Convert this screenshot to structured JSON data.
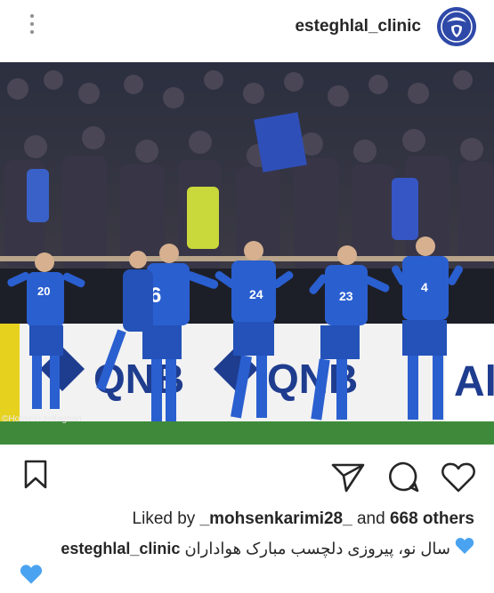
{
  "header": {
    "username": "esteghlal_clinic",
    "more_icon": "more-vertical-icon",
    "avatar_icon": "club-logo"
  },
  "photo": {
    "credit": "©Hossein.zolfaghari",
    "jersey_numbers": [
      "20",
      "6",
      "24",
      "23",
      "4"
    ],
    "sponsor": "QNB"
  },
  "actions": {
    "bookmark_icon": "bookmark-icon",
    "share_icon": "send-icon",
    "comment_icon": "comment-icon",
    "like_icon": "heart-icon"
  },
  "likes": {
    "prefix": "Liked by",
    "user": "_mohsenkarimi28_",
    "middle": "and",
    "count": "668 others"
  },
  "caption": {
    "username": "esteghlal_clinic",
    "text": "سال نو، پیروزی دلچسب مبارک  هواداران",
    "emoji": "blue-heart-icon"
  },
  "colors": {
    "jersey": "#2a5fd0",
    "heart_blue": "#4aa3f0",
    "pitch": "#3f8a3a",
    "avatar": "#2e49a8"
  }
}
